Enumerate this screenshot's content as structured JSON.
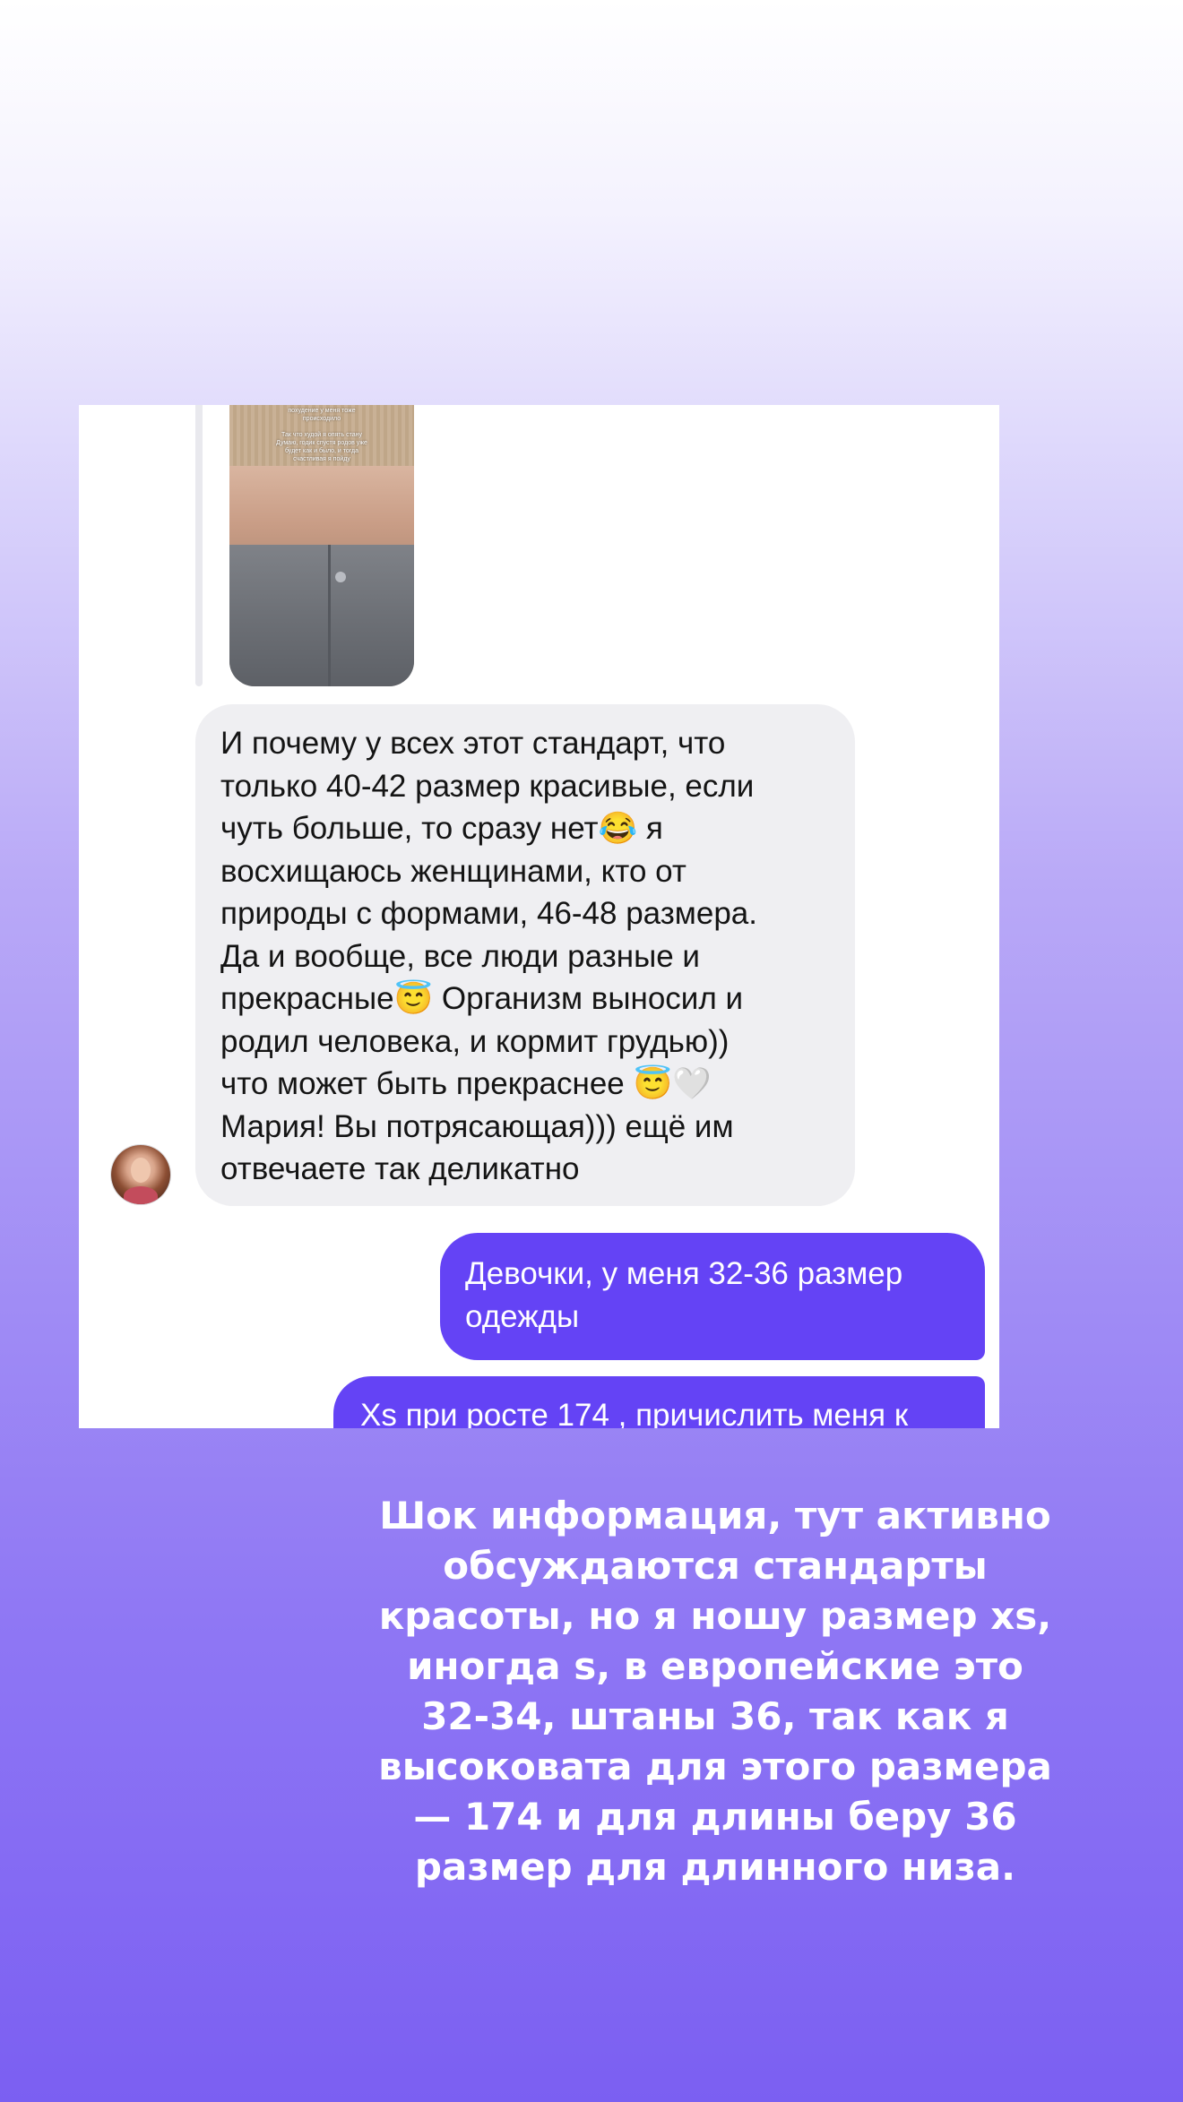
{
  "theme": {
    "background_top": "#ffffff",
    "background_bottom": "#7b5ff2",
    "incoming_bubble_color": "#efeff2",
    "outgoing_bubble_color": "#6443f5"
  },
  "chat": {
    "story_reply": {
      "preview_text": "похудение у меня тоже\nпроисходило\n\nТак что худой я опять стану\nДумаю, годик спустя родов уже\nбудет как и было, и тогда\nсчастливая я пойду",
      "thumbnail_icon": "story-thumbnail-image"
    },
    "incoming": {
      "text": "И почему у всех этот стандарт, что\nтолько 40-42 размер красивые, если\nчуть больше, то сразу нет😂 я\nвосхищаюсь женщинами, кто от\nприроды с формами, 46-48 размера.\nДа и вообще, все люди разные и\nпрекрасные😇  Организм выносил и\nродил человека, и кормит грудью))\nчто может быть прекраснее 😇🤍\nМария! Вы потрясающая))) ещё им\nотвечаете так деликатно",
      "avatar_icon": "avatar-photo"
    },
    "outgoing": [
      {
        "text": "Девочки, у меня 32-36 размер\nодежды"
      },
      {
        "text": "Xs при росте 174 , причислить меня к"
      }
    ]
  },
  "caption": {
    "text": "Шок информация, тут активно\nобсуждаются стандарты\nкрасоты, но я ношу размер xs,\nиногда s, в европейские это\n32-34, штаны 36, так как я\nвысоковата для этого размера\n— 174 и для длины беру 36\nразмер для длинного низа."
  }
}
